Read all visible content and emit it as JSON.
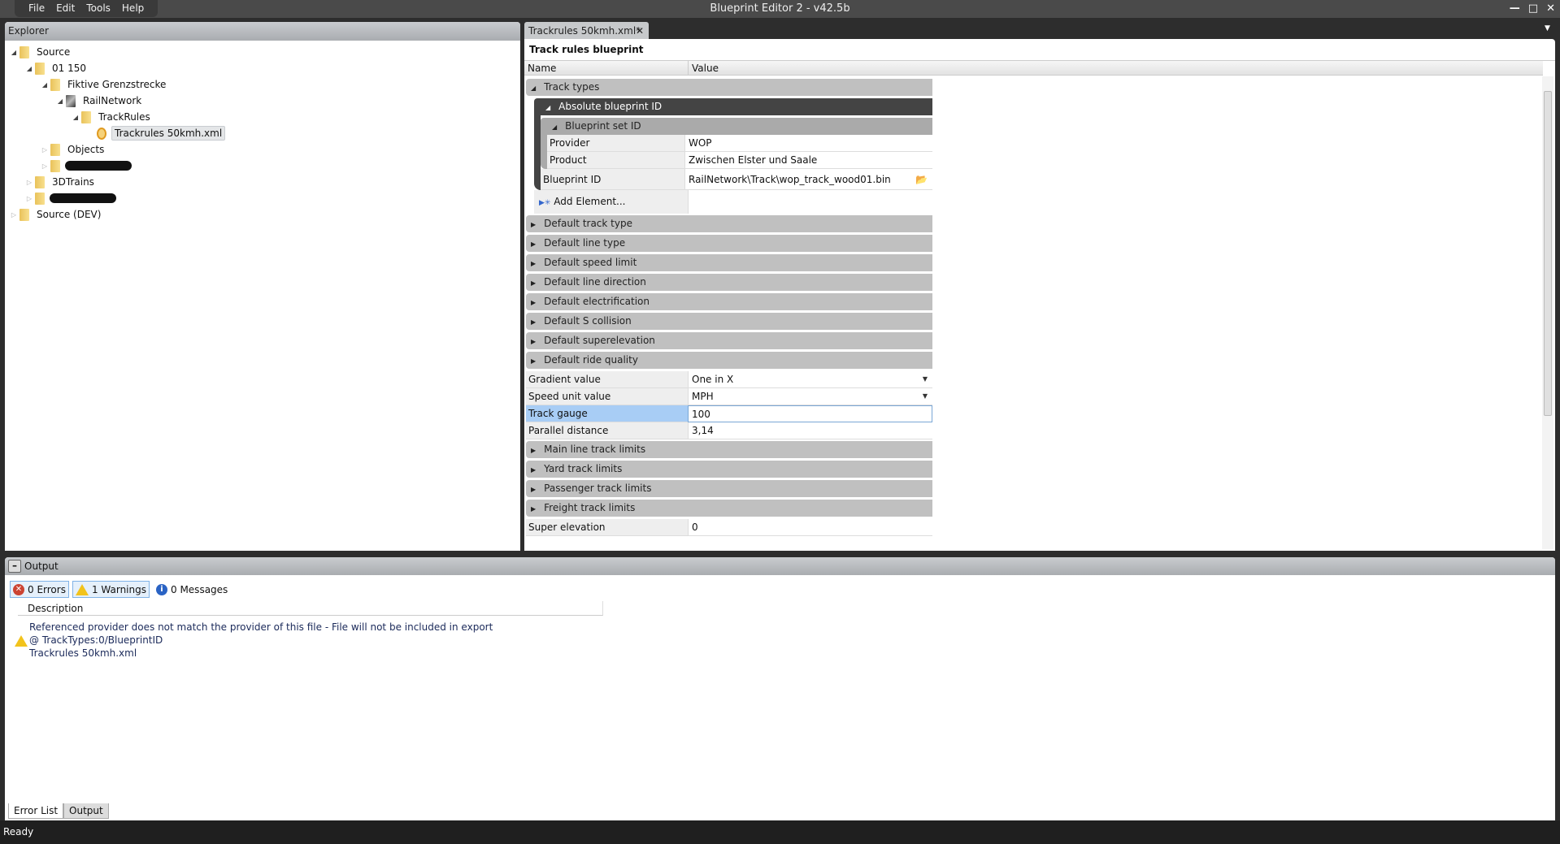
{
  "app": {
    "title": "Blueprint Editor 2 - v42.5b",
    "menu": [
      "File",
      "Edit",
      "Tools",
      "Help"
    ]
  },
  "explorer": {
    "title": "Explorer",
    "nodes": [
      {
        "label": "Source",
        "depth": 0,
        "state": "open",
        "icon": "folder"
      },
      {
        "label": "01 150",
        "depth": 1,
        "state": "open",
        "icon": "folder"
      },
      {
        "label": "Fiktive Grenzstrecke",
        "depth": 2,
        "state": "open",
        "icon": "folder"
      },
      {
        "label": "RailNetwork",
        "depth": 3,
        "state": "open",
        "icon": "rail"
      },
      {
        "label": "TrackRules",
        "depth": 4,
        "state": "open",
        "icon": "folder"
      },
      {
        "label": "Trackrules 50kmh.xml",
        "depth": 5,
        "state": "leaf",
        "icon": "file",
        "selected": true
      },
      {
        "label": "Objects",
        "depth": 2,
        "state": "closed",
        "icon": "folder"
      },
      {
        "label": "",
        "depth": 2,
        "state": "closed",
        "icon": "folder",
        "redacted": true
      },
      {
        "label": "3DTrains",
        "depth": 1,
        "state": "closed",
        "icon": "folder"
      },
      {
        "label": "",
        "depth": 1,
        "state": "closed",
        "icon": "folder",
        "redacted": true
      },
      {
        "label": "Source (DEV)",
        "depth": 0,
        "state": "closed",
        "icon": "folder"
      }
    ]
  },
  "editor": {
    "tab": "Trackrules 50kmh.xml*",
    "title": "Track rules blueprint",
    "col_name": "Name",
    "col_value": "Value",
    "track_types": "Track types",
    "absolute_id": "Absolute blueprint ID",
    "set_id": "Blueprint set ID",
    "provider": {
      "name": "Provider",
      "value": "WOP"
    },
    "product": {
      "name": "Product",
      "value": "Zwischen Elster und Saale"
    },
    "blueprint_id": {
      "name": "Blueprint ID",
      "value": "RailNetwork\\Track\\wop_track_wood01.bin"
    },
    "add_element": "Add Element...",
    "categories": [
      "Default track type",
      "Default line type",
      "Default speed limit",
      "Default line direction",
      "Default electrification",
      "Default S collision",
      "Default superelevation",
      "Default ride quality"
    ],
    "props": [
      {
        "name": "Gradient value",
        "value": "One in X",
        "dropdown": true
      },
      {
        "name": "Speed unit value",
        "value": "MPH",
        "dropdown": true
      },
      {
        "name": "Track gauge",
        "value": "100",
        "selected": true
      },
      {
        "name": "Parallel distance",
        "value": "3,14"
      }
    ],
    "categories2": [
      "Main line track limits",
      "Yard track limits",
      "Passenger track limits",
      "Freight track limits"
    ],
    "last": {
      "name": "Super elevation",
      "value": "0"
    }
  },
  "output": {
    "title": "Output",
    "errors": "0 Errors",
    "warnings": "1 Warnings",
    "messages": "0 Messages",
    "desc_header": "Description",
    "message_lines": [
      "Referenced provider does not match the provider of this file - File will not be included in export",
      "@ TrackTypes:0/BlueprintID",
      "Trackrules 50kmh.xml"
    ],
    "tabs": [
      "Error List",
      "Output"
    ]
  },
  "status": "Ready"
}
